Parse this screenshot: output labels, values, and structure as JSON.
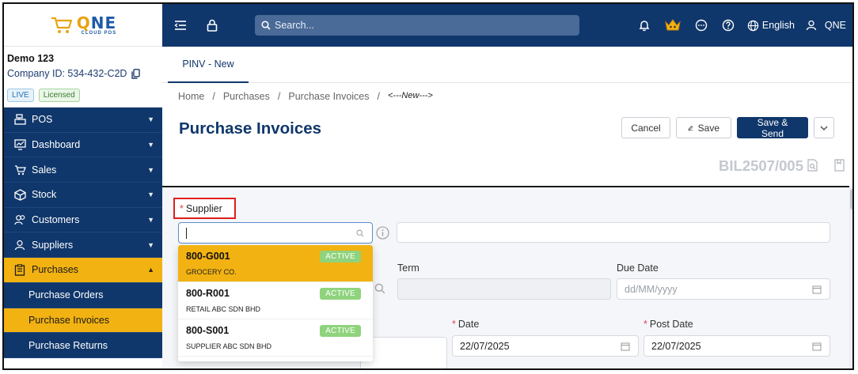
{
  "brand": {
    "logo_main": "QNE",
    "logo_sub": "CLOUD POS"
  },
  "company": {
    "name": "Demo 123",
    "id_text": "Company ID: 534-432-C2D"
  },
  "badges": {
    "live": "LIVE",
    "licensed": "Licensed"
  },
  "nav": {
    "items": [
      {
        "label": "POS",
        "icon": "register-icon"
      },
      {
        "label": "Dashboard",
        "icon": "monitor-icon"
      },
      {
        "label": "Sales",
        "icon": "cart-icon"
      },
      {
        "label": "Stock",
        "icon": "box-icon"
      },
      {
        "label": "Customers",
        "icon": "users-icon"
      },
      {
        "label": "Suppliers",
        "icon": "user-icon"
      },
      {
        "label": "Purchases",
        "icon": "clipboard-icon"
      }
    ],
    "sub_items": [
      "Purchase Orders",
      "Purchase Invoices",
      "Purchase Returns"
    ]
  },
  "topbar": {
    "search_placeholder": "Search...",
    "language": "English",
    "user": "QNE"
  },
  "tabs": {
    "active": "PINV - New"
  },
  "breadcrumb": {
    "home": "Home",
    "sep": "/",
    "purchases": "Purchases",
    "invoices": "Purchase Invoices",
    "current": "<---New--->"
  },
  "page": {
    "title": "Purchase Invoices",
    "doc_no": "BIL2507/005"
  },
  "actions": {
    "cancel": "Cancel",
    "save": "Save",
    "save_send": "Save & Send"
  },
  "form": {
    "supplier_label": "Supplier",
    "term_label": "Term",
    "due_date_label": "Due Date",
    "due_date_placeholder": "dd/MM/yyyy",
    "date_label": "Date",
    "date_value": "22/07/2025",
    "post_date_label": "Post Date",
    "post_date_value": "22/07/2025"
  },
  "supplier_options": [
    {
      "code": "800-G001",
      "name": "GROCERY CO.",
      "status": "ACTIVE"
    },
    {
      "code": "800-R001",
      "name": "RETAIL ABC SDN BHD",
      "status": "ACTIVE"
    },
    {
      "code": "800-S001",
      "name": "SUPPLIER ABC SDN BHD",
      "status": "ACTIVE"
    }
  ],
  "colors": {
    "navy": "#10376b",
    "accent": "#f2b211",
    "active_badge": "#8fd37d",
    "required": "#e04444"
  }
}
